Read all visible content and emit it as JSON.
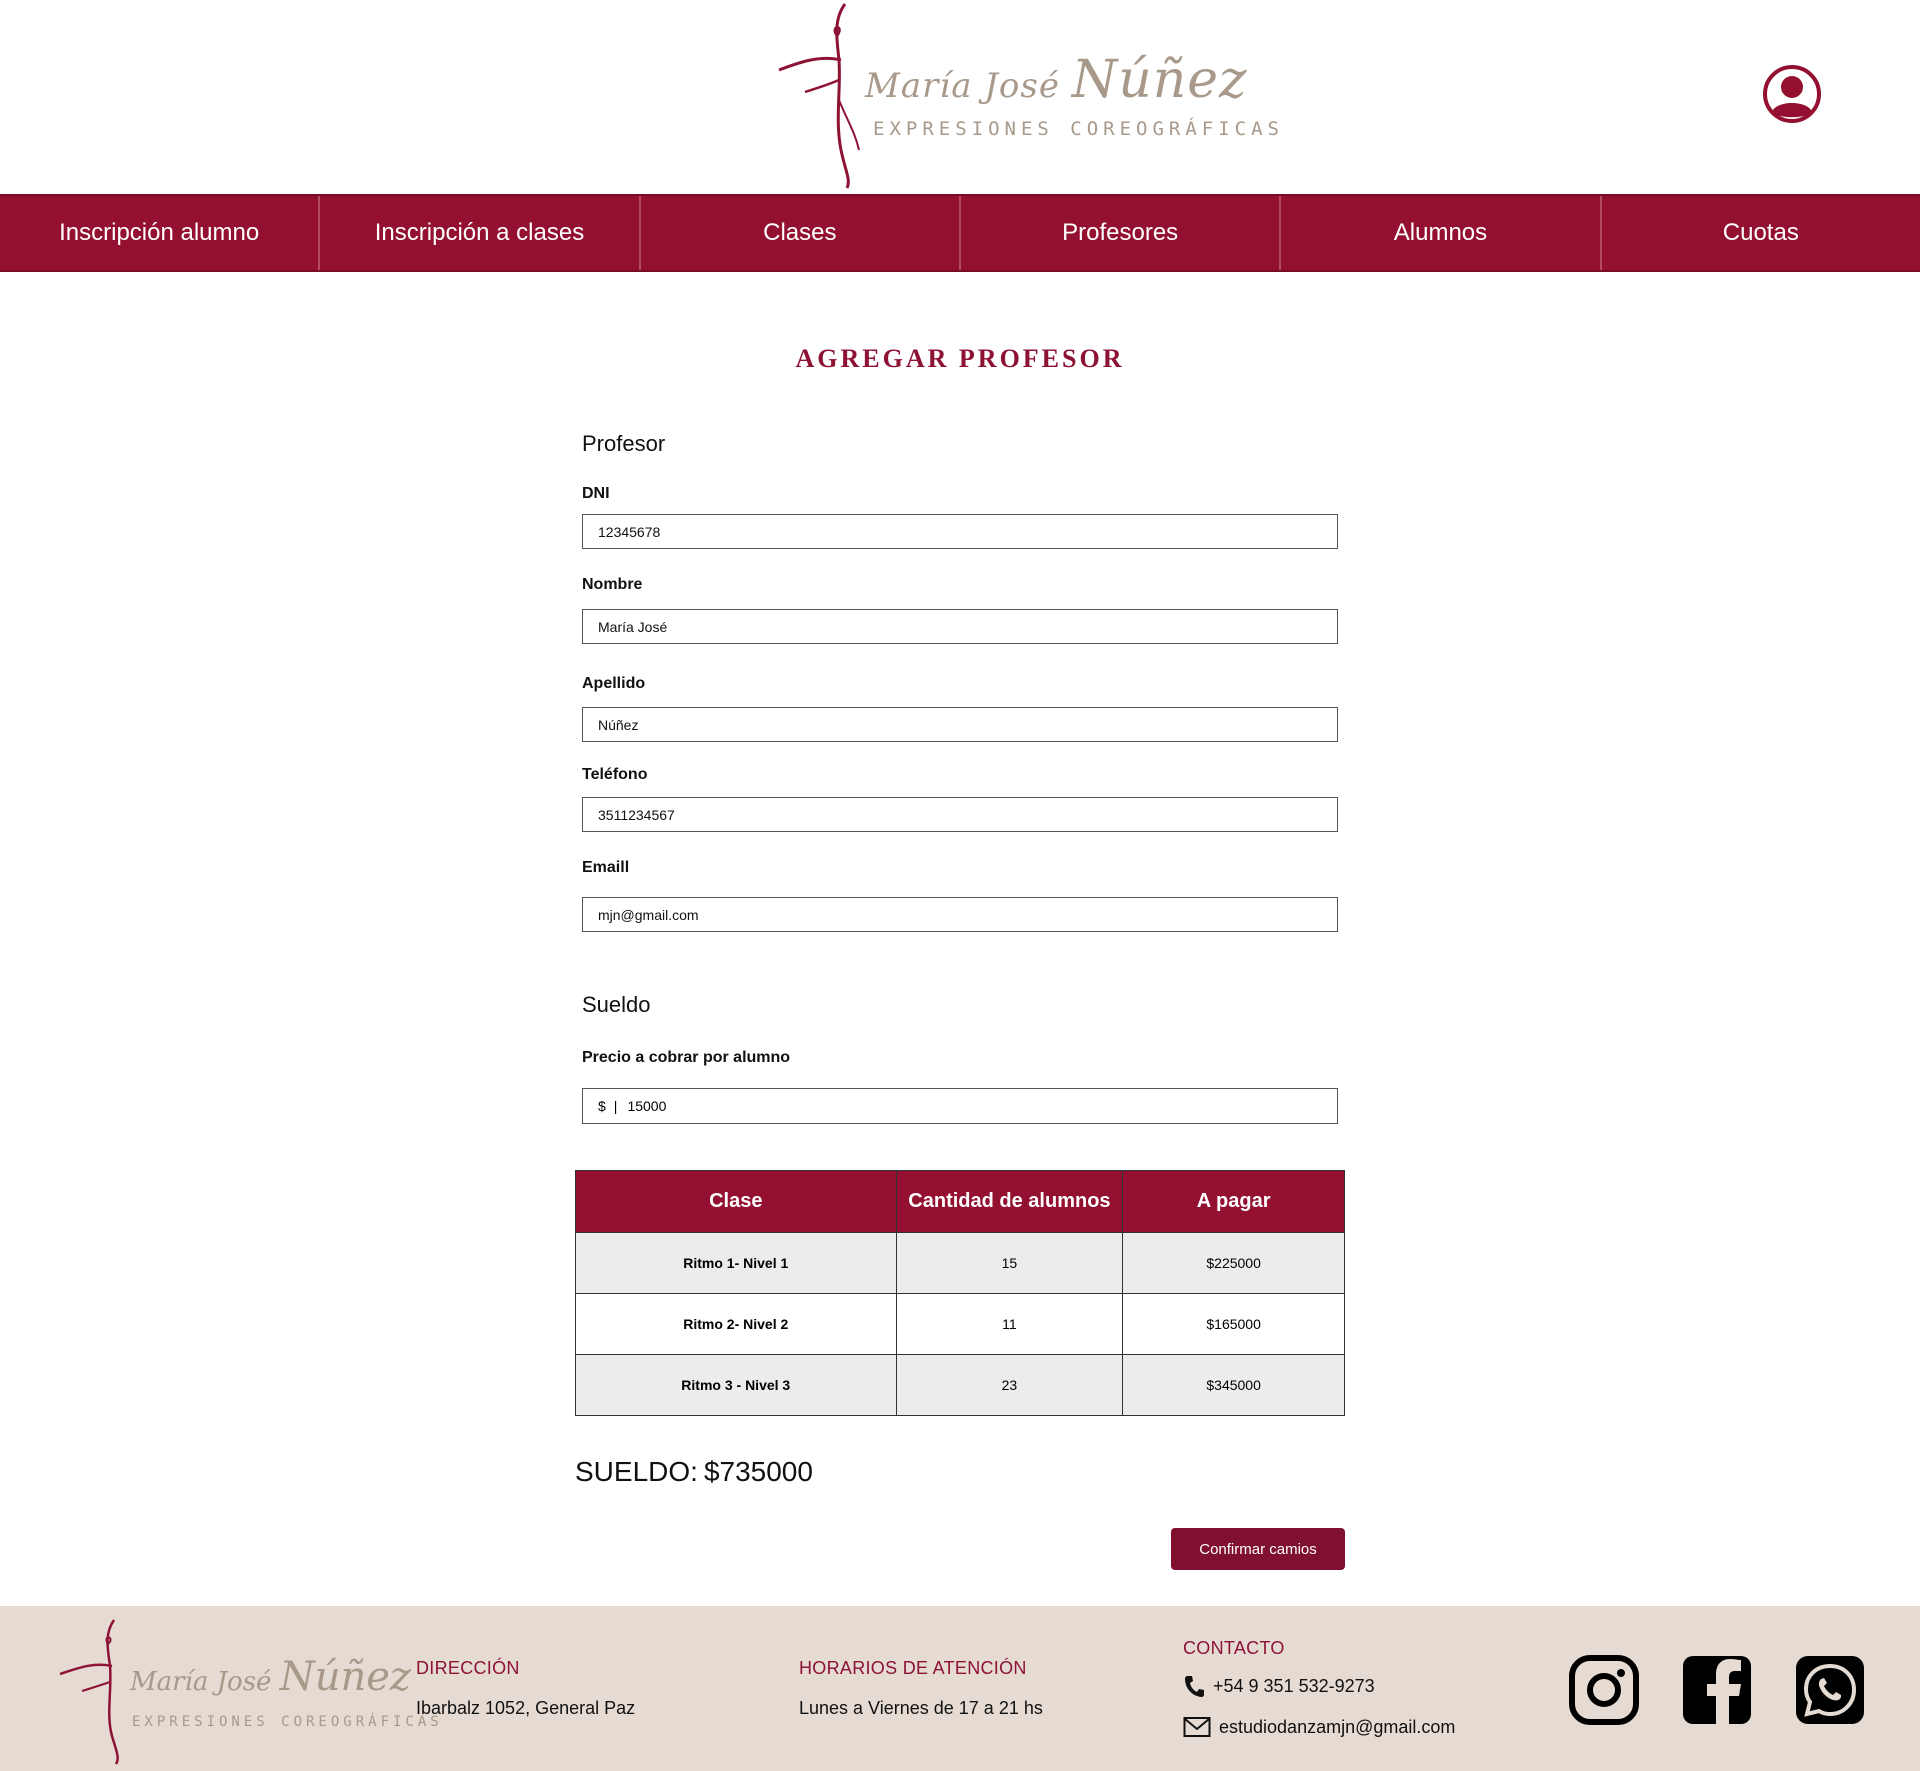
{
  "header": {
    "brand_name_part1": "María José",
    "brand_name_part2": "Núñez",
    "brand_tagline": "EXPRESIONES COREOGRÁFICAS"
  },
  "nav": {
    "items": [
      {
        "label": "Inscripción alumno"
      },
      {
        "label": "Inscripción a clases"
      },
      {
        "label": "Clases"
      },
      {
        "label": "Profesores"
      },
      {
        "label": "Alumnos"
      },
      {
        "label": "Cuotas"
      }
    ]
  },
  "page": {
    "title": "AGREGAR PROFESOR"
  },
  "profesor": {
    "section_label": "Profesor",
    "dni_label": "DNI",
    "dni_value": "12345678",
    "nombre_label": "Nombre",
    "nombre_value": "María José",
    "apellido_label": "Apellido",
    "apellido_value": "Núñez",
    "telefono_label": "Teléfono",
    "telefono_value": "3511234567",
    "email_label": "Emaill",
    "email_value": "mjn@gmail.com"
  },
  "sueldo": {
    "section_label": "Sueldo",
    "precio_label": "Precio a cobrar por alumno",
    "currency": "$",
    "separator": "|",
    "precio_value": "15000",
    "table": {
      "headers": [
        "Clase",
        "Cantidad de alumnos",
        "A pagar"
      ],
      "rows": [
        {
          "clase": "Ritmo 1- Nivel 1",
          "cantidad": "15",
          "pagar": "$225000"
        },
        {
          "clase": "Ritmo 2- Nivel 2",
          "cantidad": "11",
          "pagar": "$165000"
        },
        {
          "clase": "Ritmo 3 - Nivel 3",
          "cantidad": "23",
          "pagar": "$345000"
        }
      ]
    },
    "total_label": "SUELDO:",
    "total_value": "$735000",
    "confirm_label": "Confirmar camios"
  },
  "footer": {
    "direccion_title": "DIRECCIÓN",
    "direccion_text": "Ibarbalz 1052, General Paz",
    "horarios_title": "HORARIOS DE ATENCIÓN",
    "horarios_text": "Lunes a Viernes de 17 a 21 hs",
    "contacto_title": "CONTACTO",
    "phone": "+54 9 351 532-9273",
    "email": "estudiodanzamjn@gmail.com",
    "social_icons": [
      "instagram-icon",
      "facebook-icon",
      "whatsapp-icon"
    ]
  },
  "colors": {
    "brand": "#941030",
    "brand_dark": "#80102f",
    "logo_text": "#a8998a",
    "footer_bg": "#e5dbd2",
    "row_alt": "#ececec"
  }
}
